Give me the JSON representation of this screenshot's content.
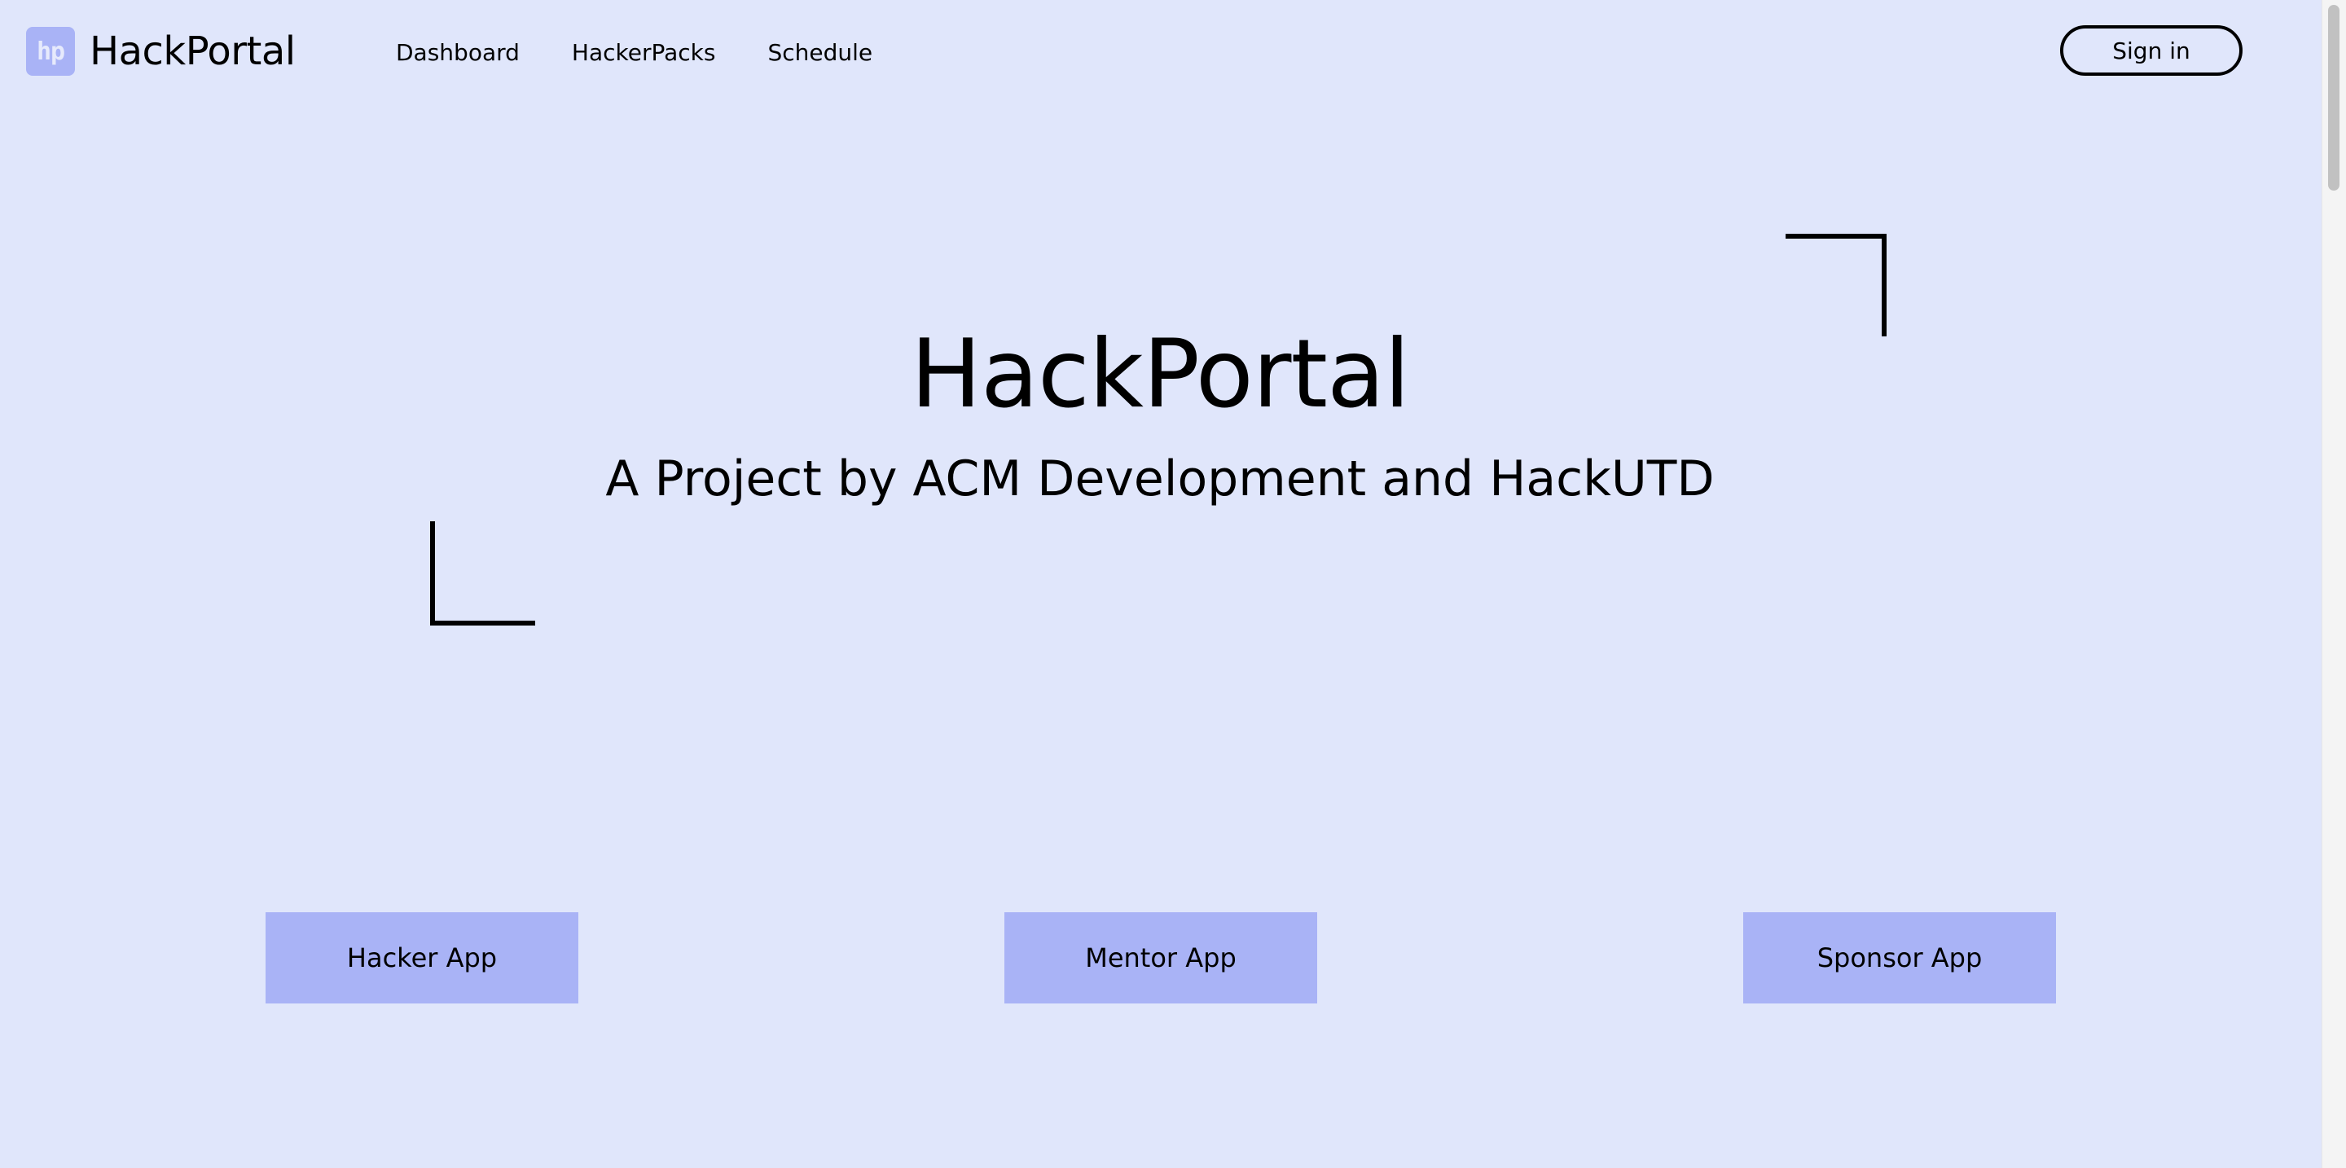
{
  "header": {
    "logo_mark": "hp",
    "logo_text": "HackPortal",
    "nav": [
      {
        "label": "Dashboard"
      },
      {
        "label": "HackerPacks"
      },
      {
        "label": "Schedule"
      }
    ],
    "signin_label": "Sign in"
  },
  "hero": {
    "title": "HackPortal",
    "subtitle": "A Project by ACM Development and HackUTD"
  },
  "apps": [
    {
      "label": "Hacker App"
    },
    {
      "label": "Mentor App"
    },
    {
      "label": "Sponsor App"
    }
  ],
  "colors": {
    "background": "#e0e6fb",
    "accent": "#a9b3f6",
    "text": "#000000"
  }
}
